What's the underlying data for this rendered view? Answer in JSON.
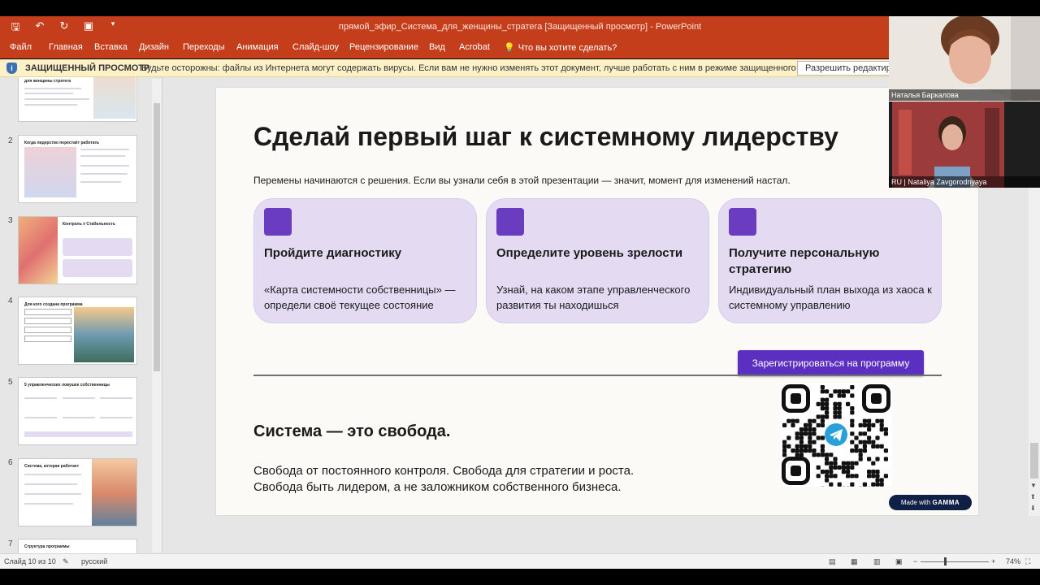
{
  "window": {
    "title": "прямой_эфир_Система_для_женщины_стратега [Защищенный просмотр] - PowerPoint"
  },
  "quick_access": {
    "save_icon": "save-icon",
    "undo_icon": "undo-icon",
    "redo_icon": "redo-icon",
    "present_icon": "start-slideshow-icon",
    "customize_icon": "customize-toolbar-icon"
  },
  "ribbon": {
    "tabs": [
      "Файл",
      "Главная",
      "Вставка",
      "Дизайн",
      "Переходы",
      "Анимация",
      "Слайд-шоу",
      "Рецензирование",
      "Вид",
      "Acrobat"
    ],
    "tell_me": "Что вы хотите сделать?"
  },
  "protected_view": {
    "title": "ЗАЩИЩЕННЫЙ ПРОСМОТР",
    "message": "Будьте осторожны: файлы из Интернета могут содержать вирусы. Если вам не нужно изменять этот документ, лучше работать с ним в режиме защищенного просмотра.",
    "button": "Разрешить редактирование"
  },
  "thumbnails": [
    {
      "number": "",
      "title": "для женщины стратега"
    },
    {
      "number": "2",
      "title": "Когда лидерство перестаёт работать"
    },
    {
      "number": "3",
      "title": "Контроль ≠ Стабильность"
    },
    {
      "number": "4",
      "title": "Для кого создана программа"
    },
    {
      "number": "5",
      "title": "5 управленческих ловушек собственницы"
    },
    {
      "number": "6",
      "title": "Система, которая работает"
    },
    {
      "number": "7",
      "title": "Структура программы"
    }
  ],
  "slide": {
    "title": "Сделай первый шаг к системному лидерству",
    "subtitle": "Перемены начинаются с решения. Если вы узнали себя в этой презентации — значит, момент для изменений настал.",
    "cards": [
      {
        "title": "Пройдите диагностику",
        "desc": "«Карта системности собственницы» — определи своё текущее состояние"
      },
      {
        "title": "Определите уровень зрелости",
        "desc": "Узнай, на каком этапе управленческого развития ты находишься"
      },
      {
        "title": "Получите персональную стратегию",
        "desc": "Индивидуальный план выхода из хаоса к системному управлению"
      }
    ],
    "register_button": "Зарегистрироваться на программу",
    "heading2": "Система — это свобода.",
    "para_line1": "Свобода от постоянного контроля. Свобода для стратегии и роста.",
    "para_line2": "Свобода быть лидером, а не заложником собственного бизнеса.",
    "made_with": "Made with",
    "gamma": "GAMMA",
    "accent_color": "#5b2fbf",
    "card_color": "#e4dbf3",
    "qr_icon": "telegram-icon"
  },
  "status": {
    "slide_counter": "Слайд 10 из 10",
    "language": "русский",
    "zoom": "74%"
  },
  "participants": [
    {
      "name": "Наталья Баркалова"
    },
    {
      "name": "RU | Nataliya Zavgorodnyaya"
    }
  ]
}
